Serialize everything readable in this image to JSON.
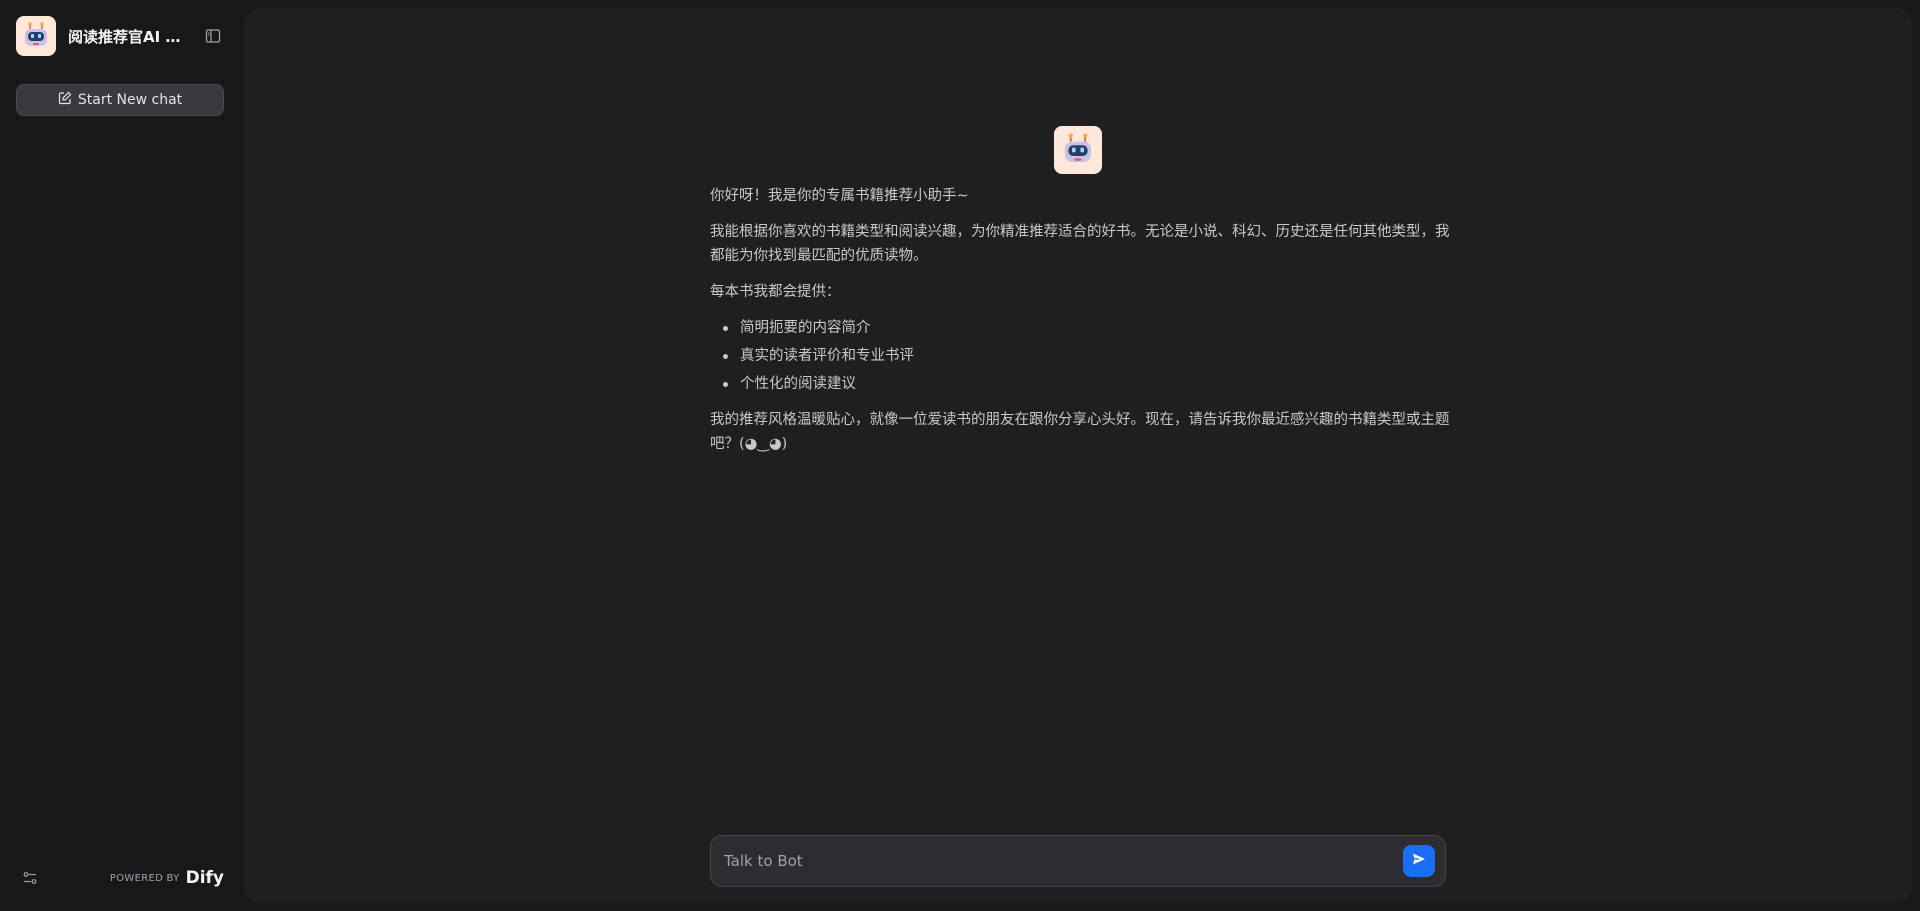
{
  "sidebar": {
    "app_title": "阅读推荐官AI A...",
    "new_chat_label": "Start New chat",
    "powered_by_label": "POWERED BY",
    "brand_name": "Dify",
    "icons": {
      "app": "robot-avatar-icon",
      "collapse": "sidebar-collapse-icon",
      "new_chat": "edit-icon",
      "settings": "sliders-icon"
    }
  },
  "chat": {
    "greeting": "你好呀！我是你的专属书籍推荐小助手~",
    "intro": "我能根据你喜欢的书籍类型和阅读兴趣，为你精准推荐适合的好书。无论是小说、科幻、历史还是任何其他类型，我都能为你找到最匹配的优质读物。",
    "provides_heading": "每本书我都会提供：",
    "provides_items": [
      "简明扼要的内容简介",
      "真实的读者评价和专业书评",
      "个性化的阅读建议"
    ],
    "closing": "我的推荐风格温暖贴心，就像一位爱读书的朋友在跟你分享心头好。现在，请告诉我你最近感兴趣的书籍类型或主题吧？(◕‿◕)"
  },
  "composer": {
    "placeholder": "Talk to Bot",
    "send_icon": "send-icon"
  },
  "colors": {
    "accent": "#1a6df5",
    "background": "#18181b",
    "panel": "#1f1f22",
    "avatar_bg": "#ffe8d9"
  }
}
